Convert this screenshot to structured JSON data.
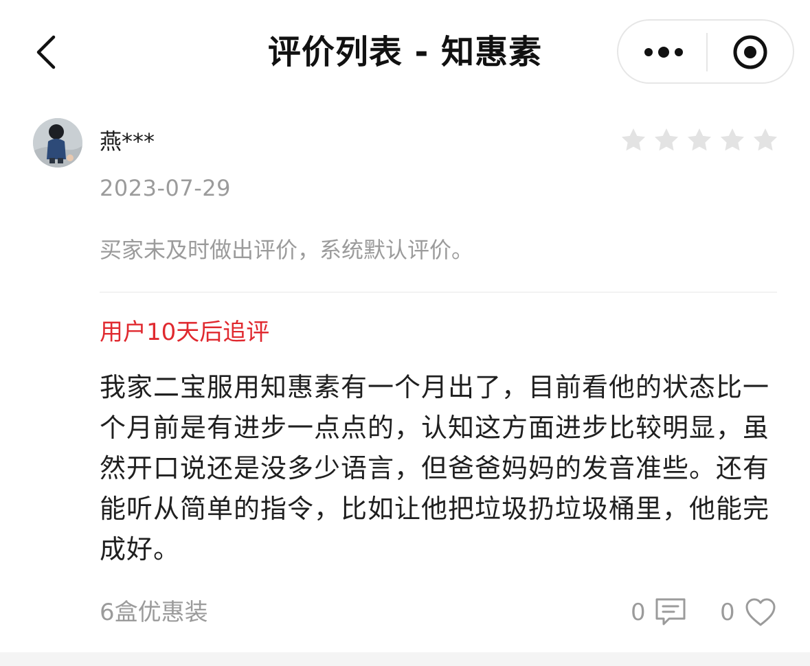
{
  "navbar": {
    "title": "评价列表 - 知惠素",
    "back_icon": "chevron-left-icon",
    "more_icon": "more-dots-icon",
    "close_icon": "target-close-icon"
  },
  "review": {
    "username": "燕***",
    "rating": 0,
    "rating_max": 5,
    "date": "2023-07-29",
    "default_text": "买家未及时做出评价，系统默认评价。",
    "followup_label": "用户10天后追评",
    "followup_text": "我家二宝服用知惠素有一个月出了，目前看他的状态比一个月前是有进步一点点的，认知这方面进步比较明显，虽然开口说还是没多少语言，但爸爸妈妈的发音准些。还有能听从简单的指令，比如让他把垃圾扔垃圾桶里，他能完成好。",
    "package": "6盒优惠装",
    "comment_count": "0",
    "like_count": "0"
  },
  "colors": {
    "accent_red": "#e0292f",
    "muted_text": "#9b9b9b",
    "star_inactive": "#e3e3e3"
  }
}
